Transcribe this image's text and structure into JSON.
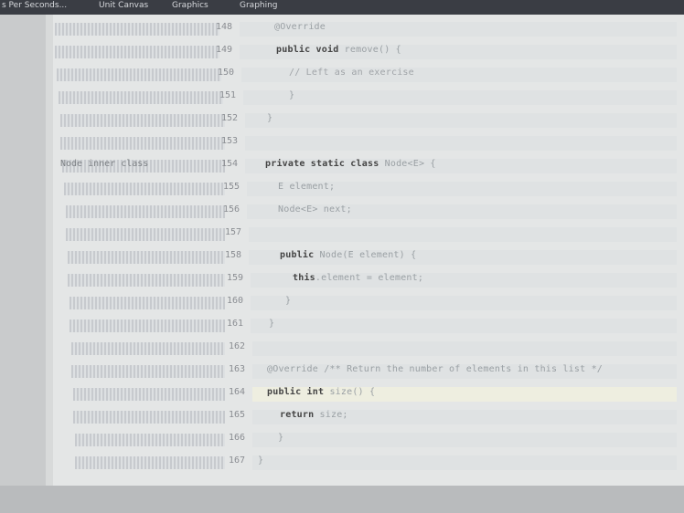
{
  "tabs": [
    "s Per Seconds...",
    "Unit Canvas",
    "Graphics",
    "Graphing"
  ],
  "editor": {
    "side_note": "Node inner class",
    "lines": [
      {
        "n": "148",
        "segments": [
          {
            "t": "@Override",
            "c": "annot"
          }
        ]
      },
      {
        "n": "149",
        "segments": [
          {
            "t": "public void ",
            "c": "kw"
          },
          {
            "t": "remove() {",
            "c": "plain"
          }
        ]
      },
      {
        "n": "150",
        "segments": [
          {
            "t": "// Left as an exercise",
            "c": "cm"
          }
        ]
      },
      {
        "n": "151",
        "segments": [
          {
            "t": "}",
            "c": "plain"
          }
        ]
      },
      {
        "n": "152",
        "segments": [
          {
            "t": "}",
            "c": "plain"
          }
        ]
      },
      {
        "n": "153",
        "segments": []
      },
      {
        "n": "154",
        "segments": [
          {
            "t": "private static class ",
            "c": "kw"
          },
          {
            "t": "Node<E> {",
            "c": "plain"
          }
        ]
      },
      {
        "n": "155",
        "segments": [
          {
            "t": "E element;",
            "c": "plain"
          }
        ]
      },
      {
        "n": "156",
        "segments": [
          {
            "t": "Node<E> next;",
            "c": "plain"
          }
        ]
      },
      {
        "n": "157",
        "segments": []
      },
      {
        "n": "158",
        "segments": [
          {
            "t": "public ",
            "c": "kw"
          },
          {
            "t": "Node(E element) {",
            "c": "plain"
          }
        ]
      },
      {
        "n": "159",
        "segments": [
          {
            "t": "this",
            "c": "kw"
          },
          {
            "t": ".element = element;",
            "c": "plain"
          }
        ]
      },
      {
        "n": "160",
        "segments": [
          {
            "t": "}",
            "c": "plain"
          }
        ]
      },
      {
        "n": "161",
        "segments": [
          {
            "t": "}",
            "c": "plain"
          }
        ]
      },
      {
        "n": "162",
        "segments": []
      },
      {
        "n": "163",
        "segments": [
          {
            "t": "@Override /** Return the number of elements in this list */",
            "c": "annot"
          }
        ]
      },
      {
        "n": "164",
        "segments": [
          {
            "t": "public int ",
            "c": "kw"
          },
          {
            "t": "size() {",
            "c": "plain"
          }
        ]
      },
      {
        "n": "165",
        "segments": [
          {
            "t": "return ",
            "c": "kw"
          },
          {
            "t": "size;",
            "c": "plain"
          }
        ]
      },
      {
        "n": "166",
        "segments": [
          {
            "t": "}",
            "c": "plain"
          }
        ]
      },
      {
        "n": "167",
        "segments": [
          {
            "t": "}",
            "c": "plain"
          }
        ]
      }
    ]
  }
}
